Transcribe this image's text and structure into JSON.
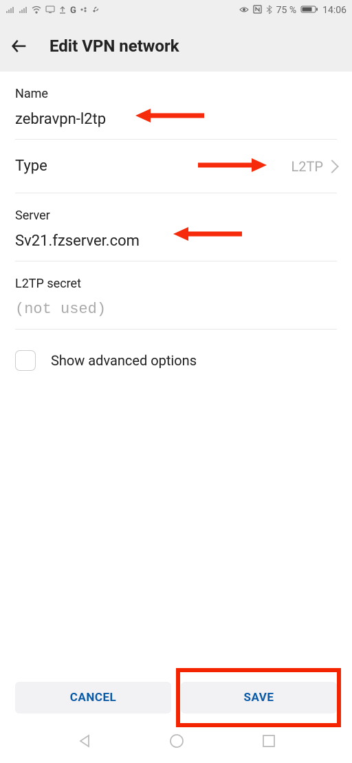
{
  "status": {
    "battery_pct": "75 %",
    "time": "14:06"
  },
  "header": {
    "title": "Edit VPN network"
  },
  "form": {
    "name_label": "Name",
    "name_value": "zebravpn-l2tp",
    "type_label": "Type",
    "type_value": "L2TP",
    "server_label": "Server",
    "server_value": "Sv21.fzserver.com",
    "secret_label": "L2TP secret",
    "secret_placeholder": "(not used)",
    "advanced_label": "Show advanced options"
  },
  "buttons": {
    "cancel": "CANCEL",
    "save": "SAVE"
  }
}
